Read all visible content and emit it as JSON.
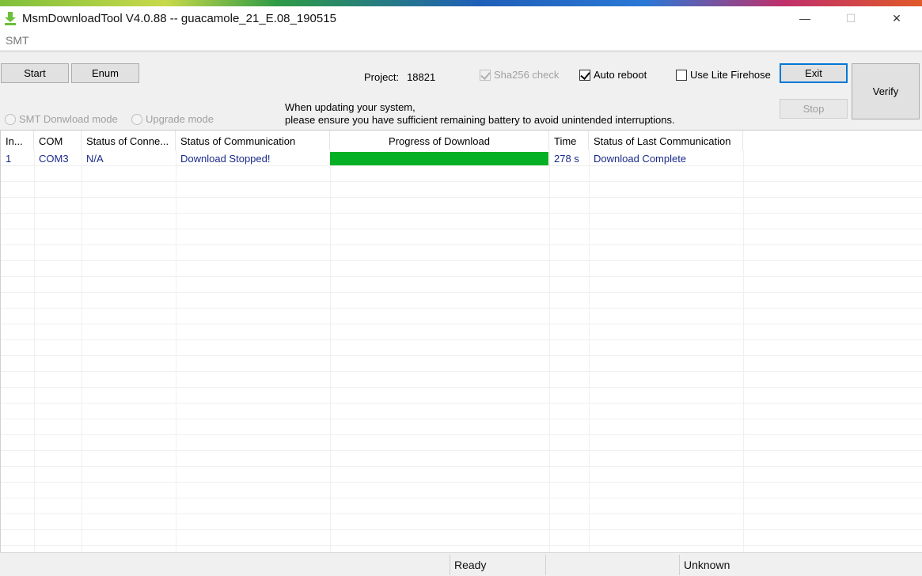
{
  "window": {
    "title": "MsmDownloadTool V4.0.88 -- guacamole_21_E.08_190515",
    "minimize_glyph": "—",
    "maximize_glyph": "☐",
    "close_glyph": "✕"
  },
  "menu": {
    "items": [
      "SMT"
    ]
  },
  "toolbar": {
    "start_label": "Start",
    "enum_label": "Enum",
    "project_label": "Project:",
    "project_value": "18821",
    "sha256_label": "Sha256 check",
    "sha256_checked": true,
    "sha256_disabled": true,
    "auto_reboot_label": "Auto reboot",
    "auto_reboot_checked": true,
    "lite_firehose_label": "Use Lite Firehose",
    "lite_firehose_checked": false,
    "exit_label": "Exit",
    "stop_label": "Stop",
    "verify_label": "Verify",
    "smt_mode_label": "SMT Donwload mode",
    "upgrade_mode_label": "Upgrade mode",
    "notice_line1": "When updating your system,",
    "notice_line2": "please ensure you have sufficient remaining battery to avoid unintended interruptions."
  },
  "table": {
    "columns": [
      "In...",
      "COM",
      "Status of Conne...",
      "Status of Communication",
      "Progress of Download",
      "Time",
      "Status of Last Communication"
    ],
    "rows": [
      {
        "index": "1",
        "com": "COM3",
        "connection": "N/A",
        "communication": "Download Stopped!",
        "progress_percent": 100,
        "time": "278 s",
        "last_communication": "Download Complete"
      }
    ]
  },
  "statusbar": {
    "status": "Ready",
    "info": "Unknown"
  },
  "colors": {
    "progress": "#06b025",
    "row_text": "#1a2a8a",
    "focus_border": "#0078d7"
  }
}
